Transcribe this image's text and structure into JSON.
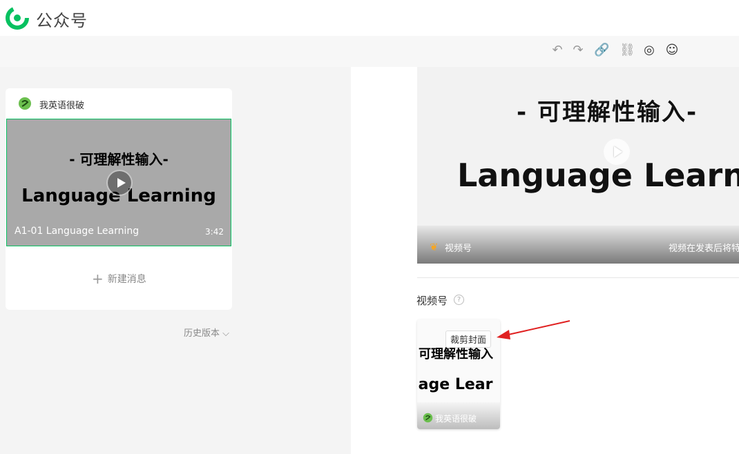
{
  "app": {
    "title": "公众号"
  },
  "toolbar": {
    "undo_icon": "undo-icon",
    "redo_icon": "redo-icon",
    "link_icon": "link-icon",
    "unlink_icon": "unlink-icon",
    "mini_program_icon": "mini-program-icon",
    "emoji_icon": "emoji-icon"
  },
  "article_list": {
    "account_name": "我英语很破",
    "item": {
      "subtitle": "- 可理解性输入-",
      "main_text": "Language Learning",
      "title": "A1-01 Language Learning",
      "duration": "3:42"
    },
    "new_message_label": "新建消息",
    "history_label": "历史版本"
  },
  "preview": {
    "subtitle": "- 可理解性输入-",
    "main_text": "Language Learnin",
    "channel_label": "视频号",
    "note": "视频在发表后将特"
  },
  "channels": {
    "section_label": "视频号",
    "help": "?",
    "cover": {
      "subtitle": "可理解性输入",
      "main_text": "uage Lear",
      "account_name": "我英语很破",
      "crop_label": "裁剪封面"
    }
  },
  "colors": {
    "accent": "#07c160",
    "arrow": "#e02020",
    "channels_brand": "#f6a623"
  }
}
